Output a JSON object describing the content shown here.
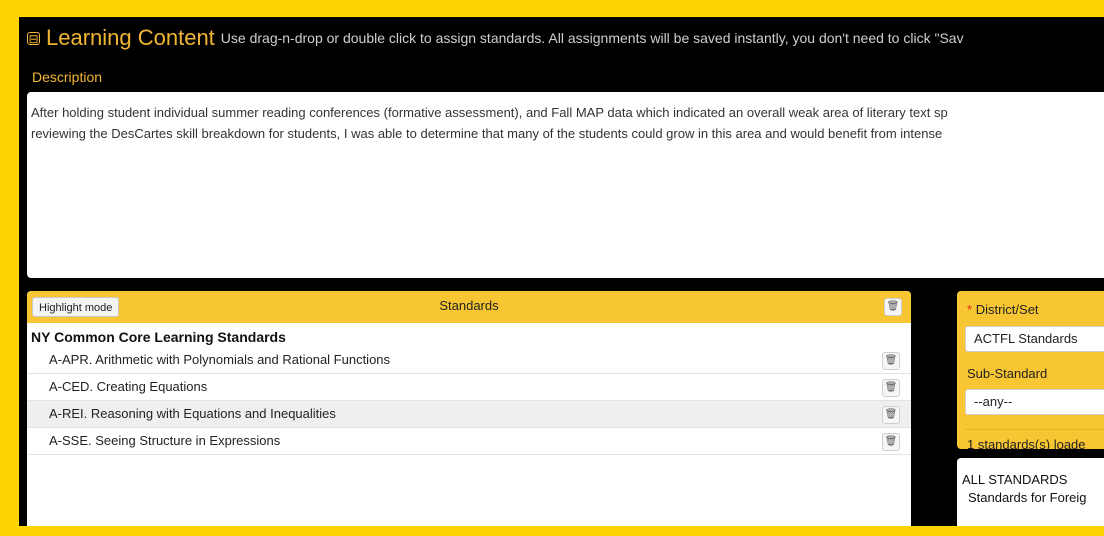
{
  "header": {
    "collapse_symbol": "⊟",
    "title": "Learning Content",
    "hint": "Use drag-n-drop or double click to assign standards. All assignments will be saved instantly, you don't need to click \"Sav"
  },
  "description": {
    "label": "Description",
    "text": "After holding student individual summer reading conferences (formative assessment), and Fall MAP data which indicated an overall weak area of literary text sp\nreviewing the DesCartes skill breakdown for students, I was able to determine that many of the students could grow in this area and would benefit from intense"
  },
  "standards": {
    "highlight_button": "Highlight mode",
    "title": "Standards",
    "group": "NY Common Core Learning Standards",
    "items": [
      {
        "label": "A-APR. Arithmetic with Polynomials and Rational Functions"
      },
      {
        "label": "A-CED. Creating Equations"
      },
      {
        "label": "A-REI. Reasoning with Equations and Inequalities"
      },
      {
        "label": "A-SSE. Seeing Structure in Expressions"
      }
    ]
  },
  "filters": {
    "required_mark": "*",
    "district_label": "District/Set",
    "district_value": "ACTFL Standards",
    "sub_label": "Sub-Standard",
    "sub_value": "--any--",
    "loaded_text": "1 standards(s) loade"
  },
  "all_standards": {
    "title": "ALL STANDARDS",
    "item": "Standards for Foreig"
  },
  "icons": {
    "collapse": "collapse-box-icon",
    "trash": "trash-icon"
  },
  "colors": {
    "accent": "#f0b533",
    "panel": "#f8c632",
    "border": "#ffd400"
  }
}
